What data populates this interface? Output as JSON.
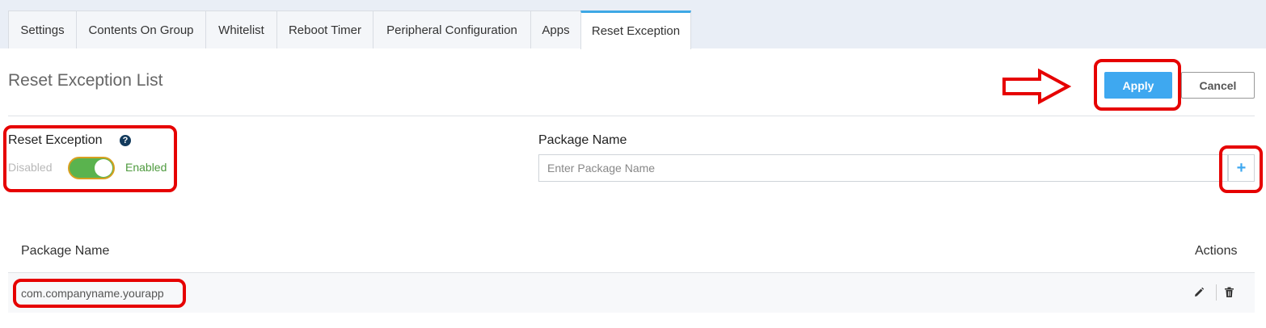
{
  "tabs": [
    {
      "label": "Settings",
      "active": false
    },
    {
      "label": "Contents On Group",
      "active": false
    },
    {
      "label": "Whitelist",
      "active": false
    },
    {
      "label": "Reboot Timer",
      "active": false
    },
    {
      "label": "Peripheral Configuration",
      "active": false
    },
    {
      "label": "Apps",
      "active": false
    },
    {
      "label": "Reset Exception",
      "active": true
    }
  ],
  "header": {
    "title": "Reset Exception List",
    "apply_label": "Apply",
    "cancel_label": "Cancel"
  },
  "reset_exception": {
    "label": "Reset Exception",
    "help_icon": "?",
    "off_label": "Disabled",
    "on_label": "Enabled",
    "enabled": true
  },
  "package_field": {
    "label": "Package Name",
    "placeholder": "Enter Package Name",
    "value": "",
    "add_label": "+"
  },
  "table": {
    "columns": [
      "Package Name",
      "Actions"
    ],
    "rows": [
      {
        "package": "com.companyname.yourapp"
      }
    ]
  },
  "colors": {
    "accent": "#3ea8f0",
    "toggle_on": "#5ab34e",
    "annotation": "#e60000"
  }
}
